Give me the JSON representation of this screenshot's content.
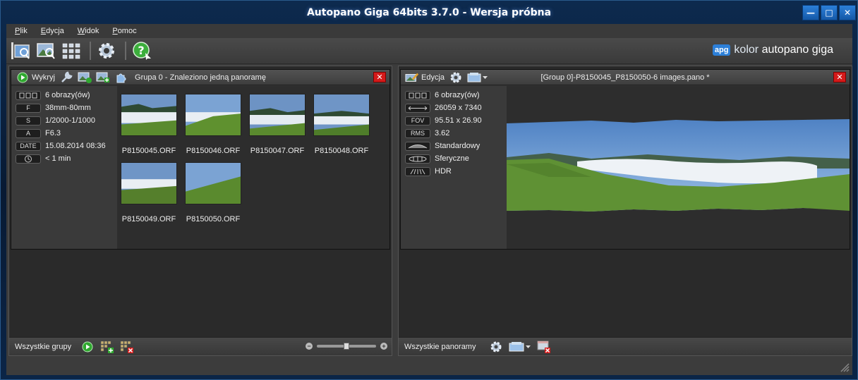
{
  "window": {
    "title": "Autopano Giga 64bits 3.7.0 - Wersja próbna"
  },
  "menu": [
    "Plik",
    "Edycja",
    "Widok",
    "Pomoc"
  ],
  "brand": {
    "badge": "apg",
    "kolor": "kolor",
    "name": "autopano giga"
  },
  "left_group": {
    "detect_label": "Wykryj",
    "title": "Grupa 0 - Znaleziono jedną panoramę",
    "info": [
      {
        "badge": "▯▯▯",
        "value": "6 obrazy(ów)"
      },
      {
        "badge": "F",
        "value": "38mm-80mm"
      },
      {
        "badge": "S",
        "value": "1/2000-1/1000"
      },
      {
        "badge": "A",
        "value": "F6.3"
      },
      {
        "badge": "DATE",
        "value": "15.08.2014 08:36"
      },
      {
        "badge": "clock",
        "value": "< 1 min"
      }
    ],
    "thumbnails": [
      "P8150045.ORF",
      "P8150046.ORF",
      "P8150047.ORF",
      "P8150048.ORF",
      "P8150049.ORF",
      "P8150050.ORF"
    ]
  },
  "right_group": {
    "edit_label": "Edycja",
    "title": "[Group 0]-P8150045_P8150050-6 images.pano *",
    "info": [
      {
        "badge": "▯▯▯",
        "value": "6 obrazy(ów)"
      },
      {
        "badge": "size",
        "value": "26059 x 7340"
      },
      {
        "badge": "FOV",
        "value": "95.51 x 26.90"
      },
      {
        "badge": "RMS",
        "value": "3.62"
      },
      {
        "badge": "blend",
        "value": "Standardowy"
      },
      {
        "badge": "proj",
        "value": "Sferyczne"
      },
      {
        "badge": "hdr",
        "value": "HDR"
      }
    ]
  },
  "bottom_left": {
    "label": "Wszystkie grupy",
    "zoom": 0.5
  },
  "bottom_right": {
    "label": "Wszystkie panoramy"
  },
  "colors": {
    "accent": "#2c7fd8",
    "close": "#d41a1a",
    "go": "#2fa82f"
  },
  "icons": [
    "folder-open-icon",
    "image-search-icon",
    "grid-icon",
    "settings-gear-icon",
    "help-icon",
    "play-icon",
    "wrench-icon",
    "add-image-icon",
    "puzzle-icon",
    "edit-icon",
    "render-icon",
    "remove-icon"
  ]
}
